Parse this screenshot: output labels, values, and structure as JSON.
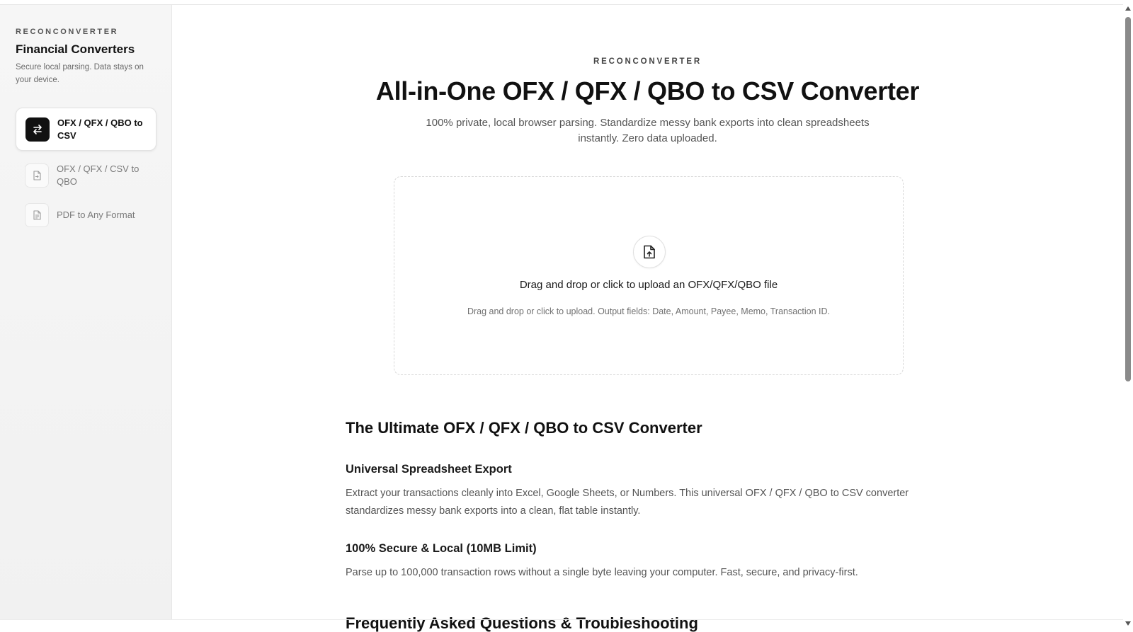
{
  "sidebar": {
    "eyebrow": "RECONCONVERTER",
    "title": "Financial Converters",
    "description": "Secure local parsing. Data stays on your device.",
    "items": [
      {
        "label": "OFX / QFX / QBO to CSV",
        "icon": "swap-arrows-icon",
        "active": true
      },
      {
        "label": "OFX / QFX / CSV to QBO",
        "icon": "file-import-icon",
        "active": false
      },
      {
        "label": "PDF to Any Format",
        "icon": "document-icon",
        "active": false
      }
    ]
  },
  "hero": {
    "eyebrow": "RECONCONVERTER",
    "title": "All-in-One OFX / QFX / QBO to CSV Converter",
    "subtitle_line1": "100% private, local browser parsing. Standardize messy bank exports into clean spreadsheets",
    "subtitle_line2": "instantly. Zero data uploaded."
  },
  "dropzone": {
    "icon": "file-upload-icon",
    "title": "Drag and drop or click to upload an OFX/QFX/QBO file",
    "hint": "Drag and drop or click to upload. Output fields: Date, Amount, Payee, Memo, Transaction ID."
  },
  "content": {
    "section_title": "The Ultimate OFX / QFX / QBO to CSV Converter",
    "features": [
      {
        "heading": "Universal Spreadsheet Export",
        "body": "Extract your transactions cleanly into Excel, Google Sheets, or Numbers. This universal OFX / QFX / QBO to CSV converter standardizes messy bank exports into a clean, flat table instantly."
      },
      {
        "heading": "100% Secure & Local (10MB Limit)",
        "body": "Parse up to 100,000 transaction rows without a single byte leaving your computer. Fast, secure, and privacy-first."
      }
    ],
    "faq_title": "Frequently Asked Questions & Troubleshooting"
  },
  "colors": {
    "accent": "#111111",
    "sidebar_bg": "#f4f4f4",
    "muted_text": "#555555"
  }
}
